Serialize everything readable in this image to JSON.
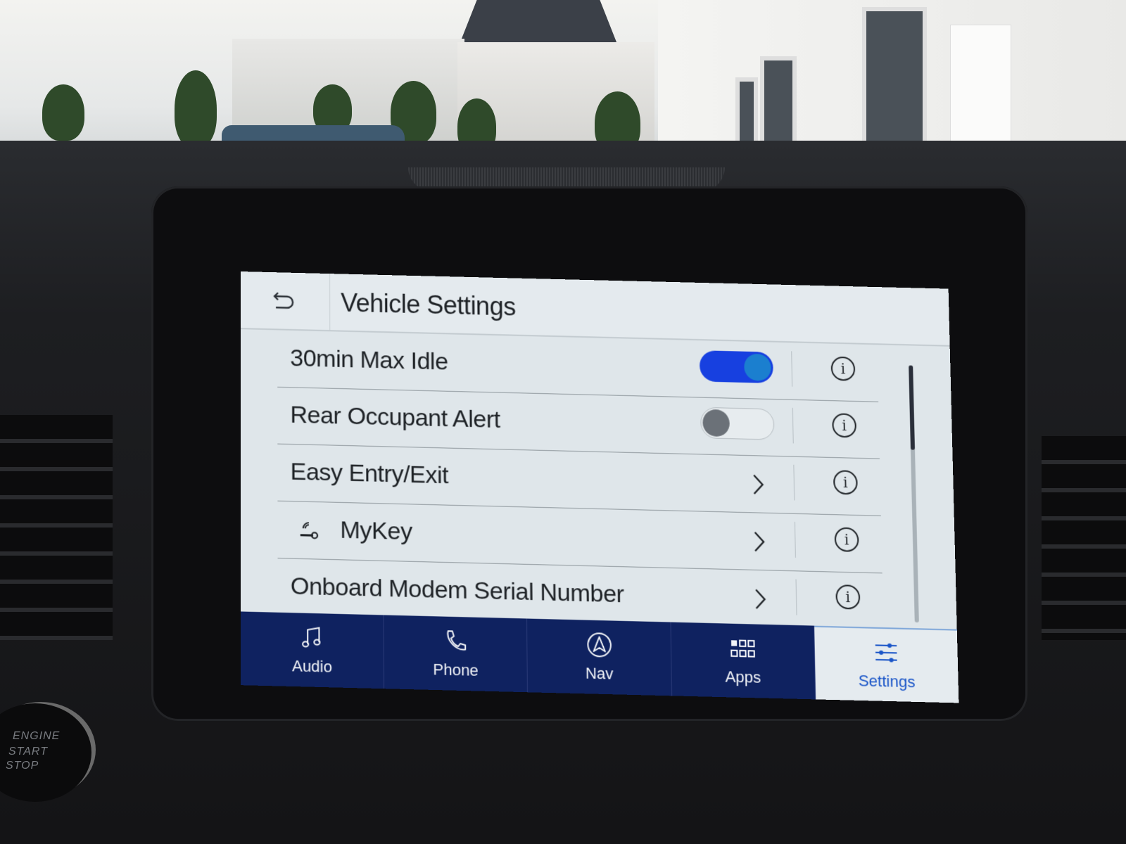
{
  "screen": {
    "header": {
      "back_label": "Back",
      "title": "Vehicle Settings"
    },
    "settings": [
      {
        "label": "30min Max Idle",
        "control": "toggle",
        "state": "on",
        "info": "i",
        "icon": null
      },
      {
        "label": "Rear Occupant Alert",
        "control": "toggle",
        "state": "off",
        "info": "i",
        "icon": null
      },
      {
        "label": "Easy Entry/Exit",
        "control": "chevron",
        "info": "i",
        "icon": null
      },
      {
        "label": "MyKey",
        "control": "chevron",
        "info": "i",
        "icon": "key-wireless-icon"
      },
      {
        "label": "Onboard Modem Serial Number",
        "control": "chevron",
        "info": "i",
        "icon": null
      }
    ],
    "scroll": {
      "position": 0,
      "visible_fraction": 0.33
    },
    "nav": {
      "items": [
        {
          "label": "Audio",
          "icon": "music-note-icon",
          "active": false
        },
        {
          "label": "Phone",
          "icon": "phone-icon",
          "active": false
        },
        {
          "label": "Nav",
          "icon": "navigation-arrow-icon",
          "active": false
        },
        {
          "label": "Apps",
          "icon": "apps-grid-icon",
          "active": false
        },
        {
          "label": "Settings",
          "icon": "sliders-icon",
          "active": true
        }
      ]
    },
    "colors": {
      "toggle_on": "#1740e0",
      "toggle_knob_on": "#1b7fcf",
      "nav_bg": "#0f2260",
      "active_label": "#1a55c8"
    }
  },
  "scene": {
    "engine_button": {
      "line1": "ENGINE",
      "line2": "START",
      "line3": "STOP"
    }
  }
}
